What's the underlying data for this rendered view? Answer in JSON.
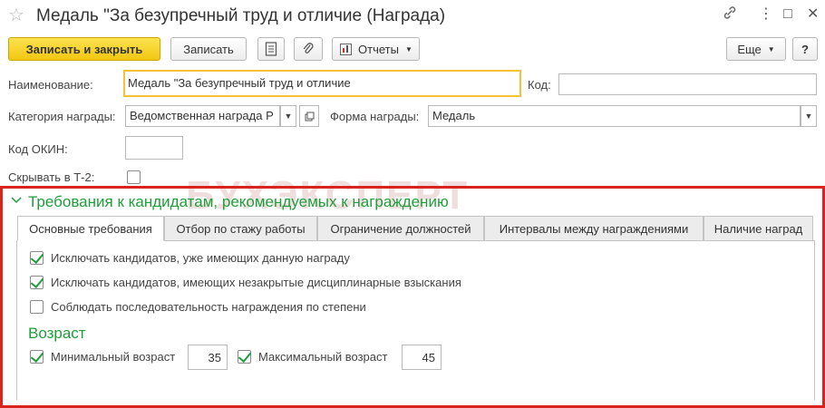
{
  "window": {
    "title": "Медаль \"За безупречный труд и отличие (Награда)",
    "star_icon": "☆",
    "link_icon": "🔗",
    "more_icon": "⋮",
    "maximize_icon": "□",
    "close_icon": "✕"
  },
  "toolbar": {
    "save_close_label": "Записать и закрыть",
    "save_label": "Записать",
    "reports_label": "Отчеты",
    "more_label": "Еще",
    "help_label": "?"
  },
  "form": {
    "name_label": "Наименование:",
    "name_value": "Медаль \"За безупречный труд и отличие",
    "code_label": "Код:",
    "code_value": "",
    "category_label": "Категория награды:",
    "category_value": "Ведомственная награда Р",
    "award_form_label": "Форма награды:",
    "award_form_value": "Медаль",
    "okin_label": "Код ОКИН:",
    "okin_value": "",
    "hide_t2_label": "Скрывать в Т-2:",
    "hide_t2_checked": false
  },
  "watermark": "БУХЭКСПЕРТ",
  "requirements": {
    "section_title": "Требования к кандидатам, рекомендуемых к награждению",
    "tabs": [
      {
        "label": "Основные требования",
        "active": true
      },
      {
        "label": "Отбор по стажу работы",
        "active": false
      },
      {
        "label": "Ограничение должностей",
        "active": false
      },
      {
        "label": "Интервалы между награждениями",
        "active": false
      },
      {
        "label": "Наличие наград",
        "active": false
      }
    ],
    "checkboxes": [
      {
        "label": "Исключать кандидатов, уже имеющих данную награду",
        "checked": true
      },
      {
        "label": "Исключать кандидатов, имеющих незакрытые дисциплинарные взыскания",
        "checked": true
      },
      {
        "label": "Соблюдать последовательность награждения по степени",
        "checked": false
      }
    ],
    "age": {
      "title": "Возраст",
      "min_label": "Минимальный возраст",
      "min_checked": true,
      "min_value": "35",
      "max_label": "Максимальный возраст",
      "max_checked": true,
      "max_value": "45"
    }
  },
  "colors": {
    "accent_yellow": "#f3c712",
    "green": "#1e9e3a",
    "highlight_red": "#d9231f"
  }
}
